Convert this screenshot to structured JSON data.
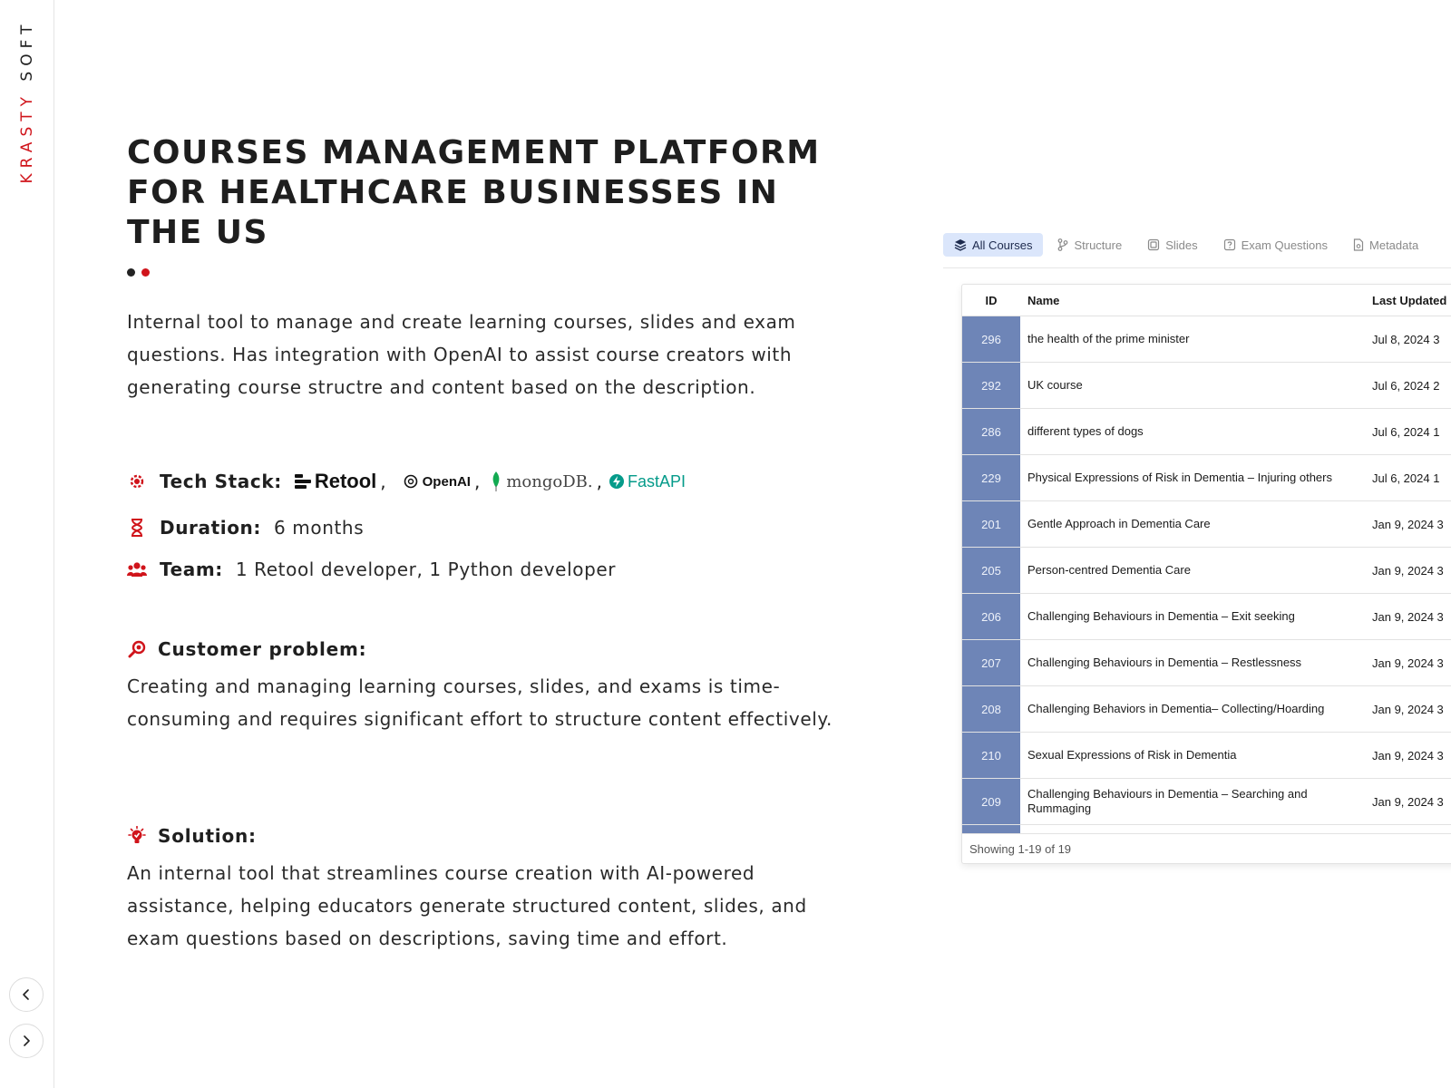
{
  "brand": {
    "logo_part1": "KRASTY",
    "logo_part2": "SOFT"
  },
  "nav": {
    "prev_icon": "chevron-left-icon",
    "next_icon": "chevron-right-icon"
  },
  "title": "COURSES MANAGEMENT PLATFORM FOR HEALTHCARE BUSINESSES IN THE US",
  "intro": "Internal tool to manage and create learning courses, slides and exam questions. Has integration with OpenAI to assist course creators with generating course structre and content based on the description.",
  "tech_stack": {
    "label": "Tech Stack:",
    "icon": "gear-brain-icon",
    "items": [
      "Retool",
      "OpenAI",
      "mongoDB.",
      "FastAPI"
    ]
  },
  "duration": {
    "label": "Duration:",
    "value": "6 months",
    "icon": "hourglass-icon"
  },
  "team": {
    "label": "Team:",
    "value": "1 Retool developer, 1 Python developer",
    "icon": "users-icon"
  },
  "customer_problem": {
    "title": "Customer problem:",
    "text": "Creating and managing learning courses, slides, and exams is time-consuming and requires significant effort to structure content effectively.",
    "icon": "magnifier-icon"
  },
  "solution": {
    "title": "Solution:",
    "text": "An internal tool that streamlines course creation with AI-powered assistance, helping educators generate structured content, slides, and exam questions based on descriptions, saving time and effort.",
    "icon": "lightbulb-icon"
  },
  "app": {
    "tabs": [
      {
        "label": "All Courses",
        "icon": "stack-icon",
        "active": true
      },
      {
        "label": "Structure",
        "icon": "branch-icon",
        "active": false
      },
      {
        "label": "Slides",
        "icon": "slides-icon",
        "active": false
      },
      {
        "label": "Exam Questions",
        "icon": "question-icon",
        "active": false
      },
      {
        "label": "Metadata",
        "icon": "file-icon",
        "active": false
      }
    ],
    "table": {
      "columns": [
        "ID",
        "Name",
        "Last Updated"
      ],
      "rows": [
        {
          "id": "296",
          "name": "the health of the prime minister",
          "updated": "Jul 8, 2024 3"
        },
        {
          "id": "292",
          "name": "UK course",
          "updated": "Jul 6, 2024 2"
        },
        {
          "id": "286",
          "name": "different types of dogs",
          "updated": "Jul 6, 2024 1"
        },
        {
          "id": "229",
          "name": "Physical Expressions of Risk in Dementia – Injuring others",
          "updated": "Jul 6, 2024 1"
        },
        {
          "id": "201",
          "name": "Gentle Approach in Dementia Care",
          "updated": "Jan 9, 2024 3"
        },
        {
          "id": "205",
          "name": "Person-centred Dementia Care",
          "updated": "Jan 9, 2024 3"
        },
        {
          "id": "206",
          "name": "Challenging Behaviours in Dementia – Exit seeking",
          "updated": "Jan 9, 2024 3"
        },
        {
          "id": "207",
          "name": "Challenging Behaviours in Dementia – Restlessness",
          "updated": "Jan 9, 2024 3"
        },
        {
          "id": "208",
          "name": "Challenging Behaviors in Dementia– Collecting/Hoarding",
          "updated": "Jan 9, 2024 3"
        },
        {
          "id": "210",
          "name": "Sexual Expressions of Risk in Dementia",
          "updated": "Jan 9, 2024 3"
        },
        {
          "id": "209",
          "name": "Challenging Behaviours in Dementia – Searching and Rummaging",
          "updated": "Jan 9, 2024 3"
        }
      ],
      "footer": "Showing 1-19 of 19"
    }
  },
  "colors": {
    "accent_red": "#d0141b",
    "id_cell": "#6e85b7",
    "active_tab": "#dbe6fb",
    "fastapi": "#059b8a"
  }
}
